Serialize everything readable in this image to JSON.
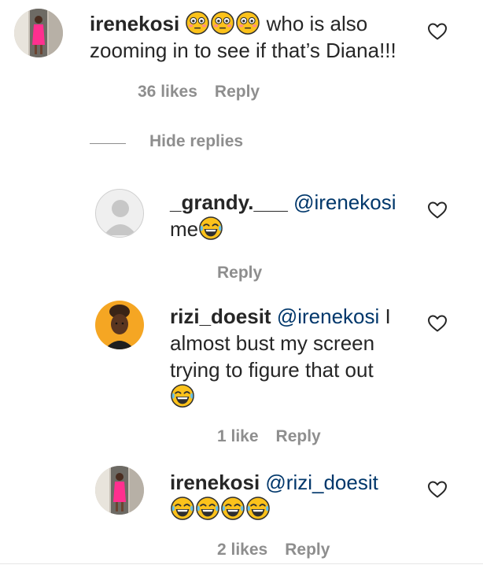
{
  "comments": [
    {
      "username": "irenekosi",
      "text_after_emoji": " who is also zooming in to see if that’s Diana!!!",
      "emoji_count": 3,
      "emoji_kind": "flushed",
      "likes": "36 likes",
      "reply_label": "Reply"
    }
  ],
  "hide_replies_label": "Hide replies",
  "replies": [
    {
      "username": "_grandy.___",
      "mention": "@irenekosi",
      "text": "me",
      "emoji_count": 1,
      "reply_label": "Reply"
    },
    {
      "username": "rizi_doesit",
      "mention": "@irenekosi",
      "text_line1": " I",
      "text_line2": "almost bust my screen",
      "text_line3": "trying to figure that out",
      "emoji_count": 1,
      "likes": "1 like",
      "reply_label": "Reply"
    },
    {
      "username": "irenekosi",
      "mention": "@rizi_doesit",
      "emoji_count": 4,
      "likes": "2 likes",
      "reply_label": "Reply"
    }
  ],
  "colors": {
    "text": "#262626",
    "mention": "#00376b",
    "muted": "#8e8e8e",
    "emoji_face": "#fcc21b"
  },
  "icons": [
    "heart-icon",
    "flushed-face-emoji",
    "laughing-crying-emoji"
  ]
}
